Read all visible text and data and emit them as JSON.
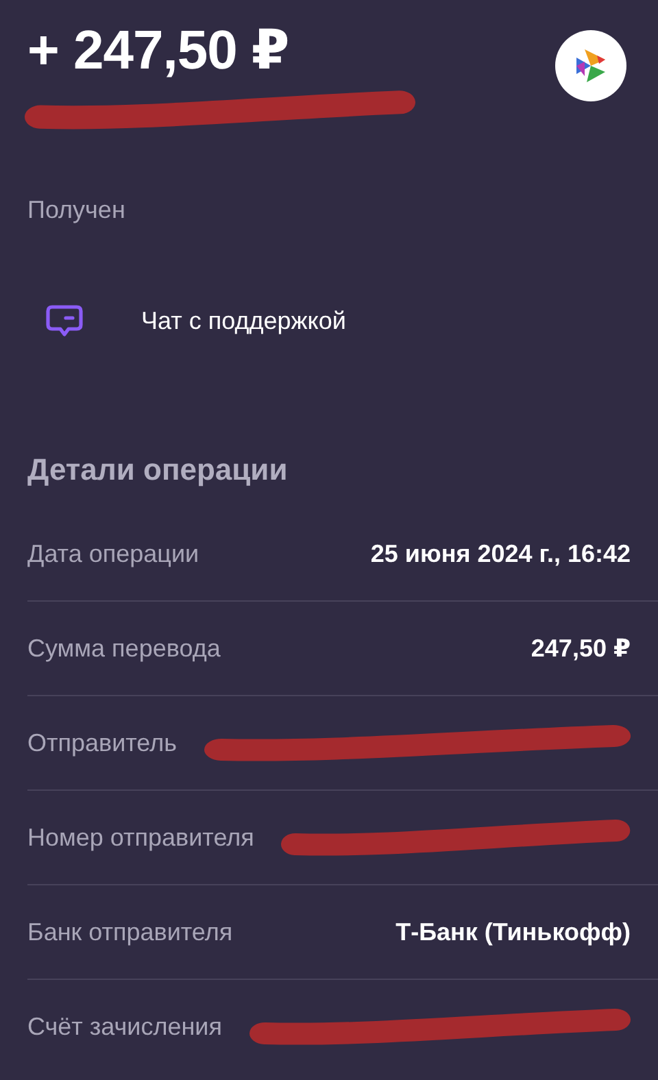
{
  "header": {
    "amount": "+ 247,50 ₽",
    "subtitle": {
      "redacted": true
    }
  },
  "status": "Получен",
  "support": {
    "label": "Чат с поддержкой"
  },
  "details": {
    "title": "Детали операции",
    "rows": [
      {
        "label": "Дата операции",
        "value": "25 июня 2024 г., 16:42"
      },
      {
        "label": "Сумма перевода",
        "value": "247,50 ₽"
      },
      {
        "label": "Отправитель",
        "redacted": true
      },
      {
        "label": "Номер отправителя",
        "redacted": true
      },
      {
        "label": "Банк отправителя",
        "value": "Т-Банк (Тинькофф)"
      },
      {
        "label": "Счёт зачисления",
        "redacted": true
      }
    ]
  }
}
